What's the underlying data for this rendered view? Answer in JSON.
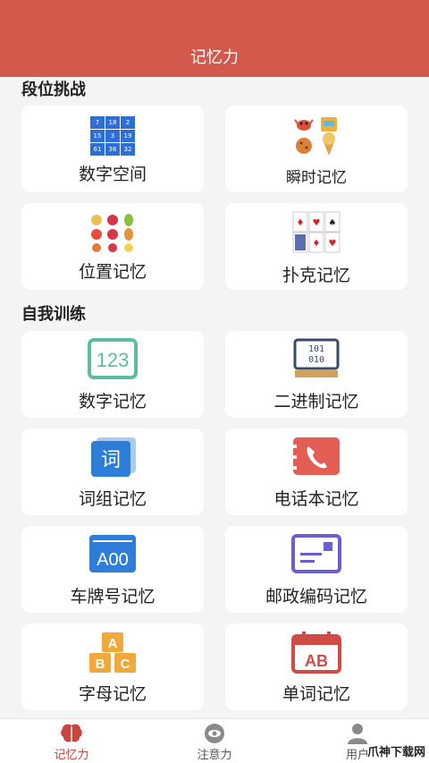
{
  "header": {
    "title": "记忆力"
  },
  "sections": [
    {
      "title": "段位挑战"
    },
    {
      "title": "自我训练"
    }
  ],
  "challenge_cards": [
    {
      "label": "数字空间",
      "grid_numbers": [
        "7",
        "18",
        "2",
        "15",
        "3",
        "19",
        "61",
        "36",
        "32"
      ]
    },
    {
      "label": "瞬时记忆"
    },
    {
      "label": "位置记忆"
    },
    {
      "label": "扑克记忆"
    }
  ],
  "training_cards": [
    {
      "label": "数字记忆",
      "icon_text": "123"
    },
    {
      "label": "二进制记忆",
      "icon_text_1": "101",
      "icon_text_2": "010"
    },
    {
      "label": "词组记忆",
      "icon_text": "词"
    },
    {
      "label": "电话本记忆"
    },
    {
      "label": "车牌号记忆",
      "icon_text": "A00"
    },
    {
      "label": "邮政编码记忆"
    },
    {
      "label": "字母记忆",
      "icon_letters": [
        "A",
        "B",
        "C"
      ]
    },
    {
      "label": "单词记忆",
      "icon_text": "AB"
    }
  ],
  "tabbar": [
    {
      "label": "记忆力",
      "active": true
    },
    {
      "label": "注意力",
      "active": false
    },
    {
      "label": "用户",
      "active": false
    }
  ],
  "watermark": "爪神下载网",
  "colors": {
    "header": "#d4594d",
    "active_tab": "#c9443c"
  }
}
